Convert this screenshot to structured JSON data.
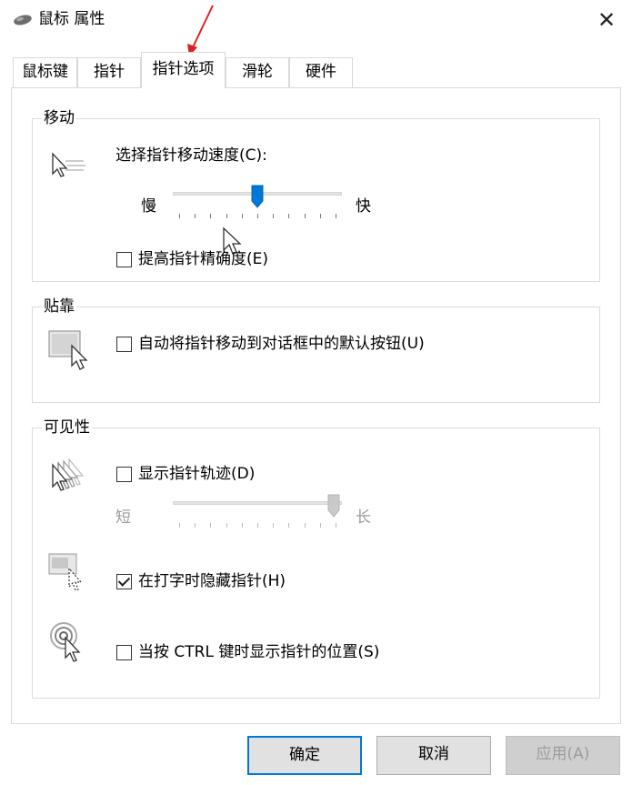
{
  "window": {
    "title": "鼠标 属性",
    "close_symbol": "✕"
  },
  "tabs": [
    {
      "label": "鼠标键",
      "active": false
    },
    {
      "label": "指针",
      "active": false
    },
    {
      "label": "指针选项",
      "active": true
    },
    {
      "label": "滑轮",
      "active": false
    },
    {
      "label": "硬件",
      "active": false
    }
  ],
  "motion": {
    "group_label": "移动",
    "speed_label": "选择指针移动速度(C):",
    "slow_label": "慢",
    "fast_label": "快",
    "speed_level": 0.5,
    "enhance_precision_label": "提高指针精确度(E)",
    "enhance_precision_checked": false
  },
  "snap_to": {
    "group_label": "贴靠",
    "snap_label": "自动将指针移动到对话框中的默认按钮(U)",
    "snap_checked": false
  },
  "visibility": {
    "group_label": "可见性",
    "trails_label": "显示指针轨迹(D)",
    "trails_checked": false,
    "short_label": "短",
    "long_label": "长",
    "trails_level": 1.0,
    "hide_typing_label": "在打字时隐藏指针(H)",
    "hide_typing_checked": true,
    "ctrl_location_label": "当按 CTRL 键时显示指针的位置(S)",
    "ctrl_location_checked": false
  },
  "buttons": {
    "ok": "确定",
    "cancel": "取消",
    "apply": "应用(A)"
  },
  "colors": {
    "accent": "#0078d7",
    "annotation": "#e02020"
  },
  "icons": [
    "mouse-icon",
    "close-icon",
    "pointer-speed-icon",
    "snap-to-icon",
    "pointer-trails-icon",
    "hide-pointer-icon",
    "ctrl-locate-icon"
  ]
}
